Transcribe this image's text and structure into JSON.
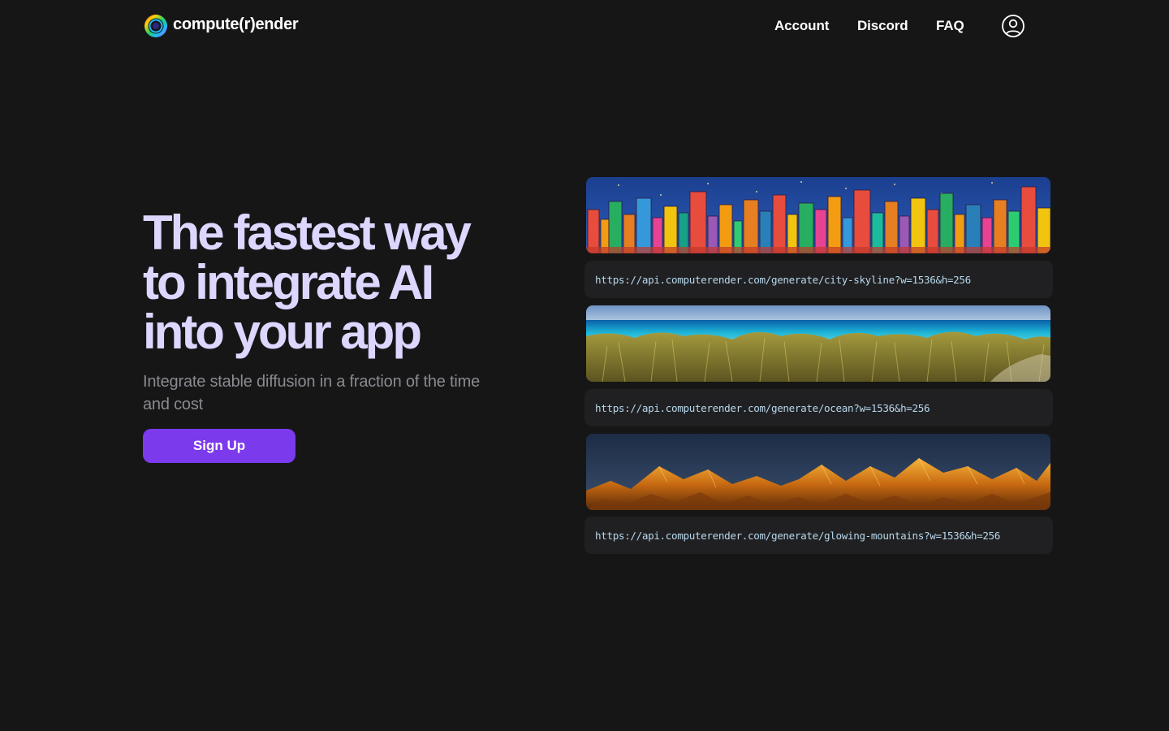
{
  "brand": {
    "name": "compute(r)ender",
    "logo_icon": "rainbow-ring-icon"
  },
  "nav": {
    "items": [
      {
        "label": "Account"
      },
      {
        "label": "Discord"
      },
      {
        "label": "FAQ"
      }
    ],
    "profile_icon": "user-circle-icon"
  },
  "hero": {
    "title": "The fastest way to integrate AI into your app",
    "subtitle": "Integrate stable diffusion in a fraction of the time and cost",
    "cta_label": "Sign Up"
  },
  "examples": [
    {
      "image": "city-skyline-image",
      "url": "https://api.computerender.com/generate/city-skyline?w=1536&h=256"
    },
    {
      "image": "ocean-image",
      "url": "https://api.computerender.com/generate/ocean?w=1536&h=256"
    },
    {
      "image": "glowing-mountains-image",
      "url": "https://api.computerender.com/generate/glowing-mountains?w=1536&h=256"
    }
  ],
  "colors": {
    "background": "#161617",
    "title": "#ddd6fe",
    "subtitle": "#8a8a90",
    "accent": "#7c3aed",
    "url_box": "#202022",
    "url_text": "#b7d8ec"
  }
}
